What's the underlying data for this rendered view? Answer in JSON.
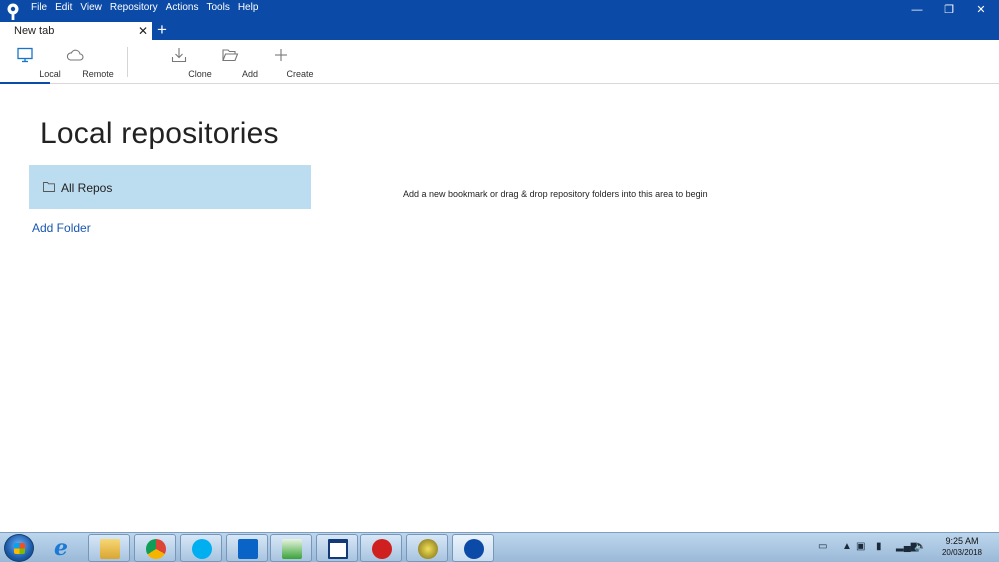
{
  "menu": [
    "File",
    "Edit",
    "View",
    "Repository",
    "Actions",
    "Tools",
    "Help"
  ],
  "window_controls": {
    "minimize": "—",
    "restore": "❐",
    "close": "✕"
  },
  "tabs": [
    {
      "label": "New tab",
      "close": "✕"
    }
  ],
  "new_tab": "+",
  "toolbar": {
    "local": "Local",
    "remote": "Remote",
    "clone": "Clone",
    "add": "Add",
    "create": "Create"
  },
  "main": {
    "title": "Local repositories",
    "all_repos": "All Repos",
    "add_folder": "Add Folder",
    "hint": "Add a new bookmark or drag & drop repository folders into this area to begin"
  },
  "taskbar": {
    "apps": [
      "internet-explorer-icon",
      "file-explorer-icon",
      "chrome-icon",
      "skype-icon",
      "outlook-icon",
      "media-player-icon",
      "window-icon",
      "app-red-icon",
      "ultraedit-icon",
      "sourcetree-icon"
    ],
    "time": "9:25 AM",
    "date": "20/03/2018"
  },
  "colors": {
    "accent": "#0b4aa6",
    "selection": "#bcdcef",
    "link": "#1a56b0"
  }
}
